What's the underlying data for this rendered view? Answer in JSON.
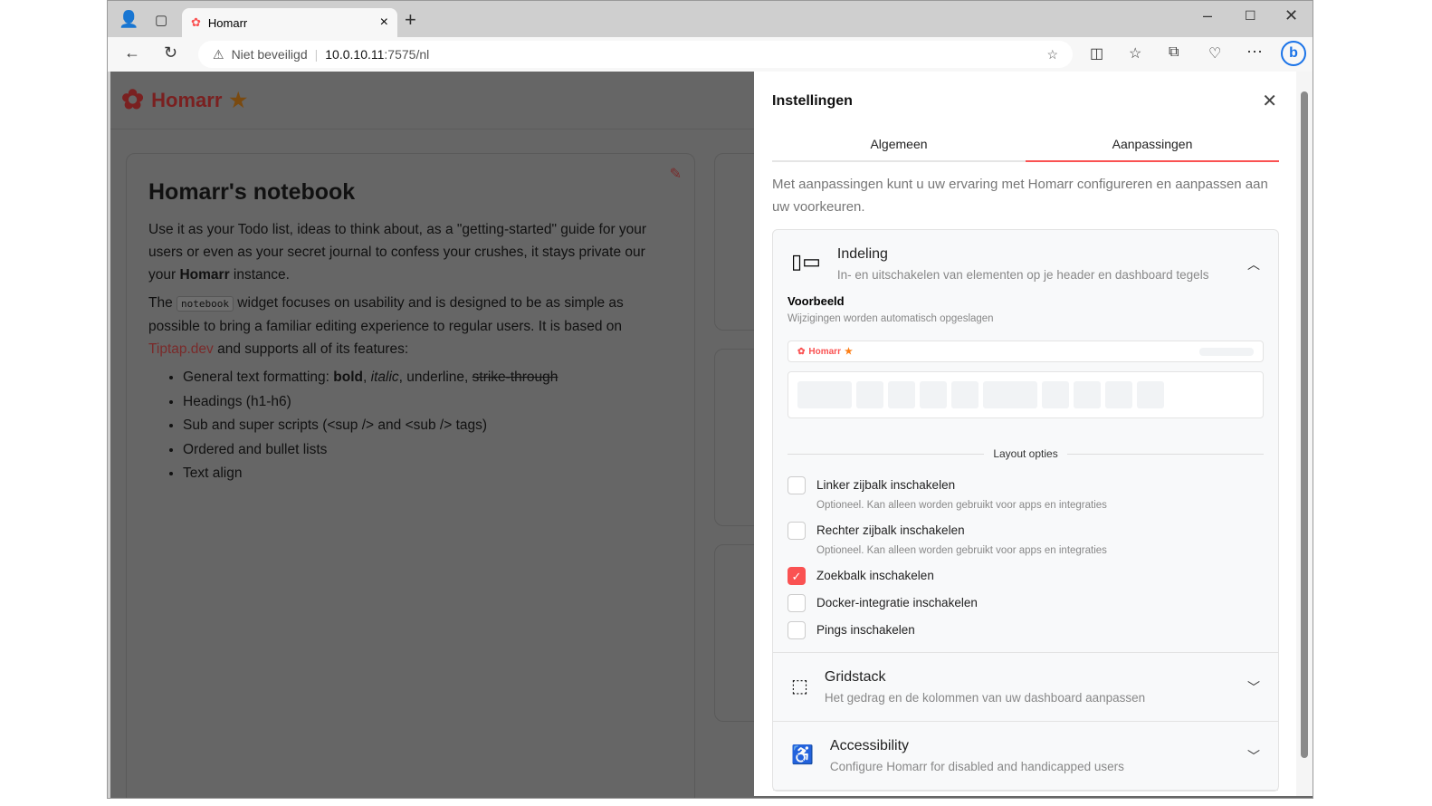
{
  "browser": {
    "tab_title": "Homarr",
    "security_label": "Niet beveiligd",
    "url_host": "10.0.10.11",
    "url_rest": ":7575/nl"
  },
  "app": {
    "name": "Homarr"
  },
  "notebook": {
    "title": "Homarr's notebook",
    "p1a": "Use it as your Todo list, ideas to think about, as a \"getting-started\" guide for your users or even as your secret journal to confess your crushes, it stays private our your ",
    "p1b": "Homarr",
    "p1c": " instance.",
    "p2a": "The ",
    "p2code": "notebook",
    "p2b": " widget focuses on usability and is designed to be as simple as possible to bring a familiar editing experience to regular users. It is based on ",
    "p2link": "Tiptap.dev",
    "p2c": " and supports all of its features:",
    "li1a": "General text formatting: ",
    "li1b": "bold",
    "li1c": ", ",
    "li1d": "italic",
    "li1e": ", underline, ",
    "li1f": "strike-through",
    "li2": "Headings (h1-h6)",
    "li3": "Sub and super scripts (<sup /> and <sub /> tags)",
    "li4": "Ordered and bullet lists",
    "li5": "Text align"
  },
  "drawer": {
    "title": "Instellingen",
    "tabs": [
      "Algemeen",
      "Aanpassingen"
    ],
    "description": "Met aanpassingen kunt u uw ervaring met Homarr configureren en aanpassen aan uw voorkeuren.",
    "sections": [
      {
        "title": "Indeling",
        "subtitle": "In- en uitschakelen van elementen op je header en dashboard tegels"
      },
      {
        "title": "Gridstack",
        "subtitle": "Het gedrag en de kolommen van uw dashboard aanpassen"
      },
      {
        "title": "Accessibility",
        "subtitle": "Configure Homarr for disabled and handicapped users"
      }
    ],
    "preview_title": "Voorbeeld",
    "preview_subtitle": "Wijzigingen worden automatisch opgeslagen",
    "preview_logo": "Homarr",
    "layout_divider": "Layout opties",
    "options": [
      {
        "label": "Linker zijbalk inschakelen",
        "hint": "Optioneel. Kan alleen worden gebruikt voor apps en integraties",
        "checked": false
      },
      {
        "label": "Rechter zijbalk inschakelen",
        "hint": "Optioneel. Kan alleen worden gebruikt voor apps en integraties",
        "checked": false
      },
      {
        "label": "Zoekbalk inschakelen",
        "checked": true
      },
      {
        "label": "Docker-integratie inschakelen",
        "checked": false
      },
      {
        "label": "Pings inschakelen",
        "checked": false
      }
    ]
  },
  "colors": {
    "accent": "#fa5252"
  }
}
